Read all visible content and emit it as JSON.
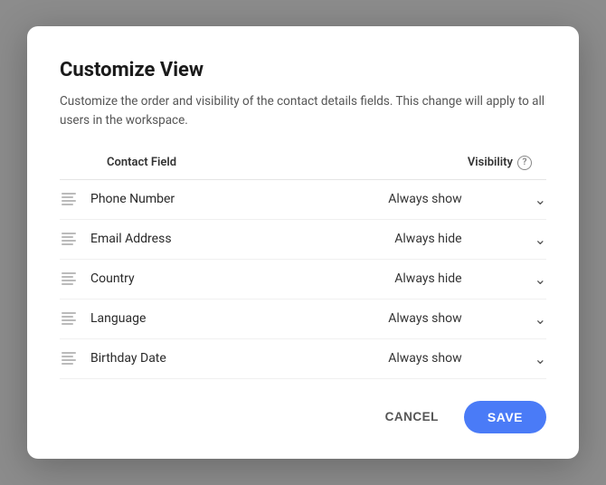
{
  "modal": {
    "title": "Customize View",
    "description": "Customize the order and visibility of the contact details fields. This change will apply to all users in the workspace.",
    "columns": {
      "field": "Contact Field",
      "visibility": "Visibility"
    },
    "rows": [
      {
        "id": "phone-number",
        "name": "Phone Number",
        "visibility": "Always show"
      },
      {
        "id": "email-address",
        "name": "Email Address",
        "visibility": "Always hide"
      },
      {
        "id": "country",
        "name": "Country",
        "visibility": "Always hide"
      },
      {
        "id": "language",
        "name": "Language",
        "visibility": "Always show"
      },
      {
        "id": "birthday-date",
        "name": "Birthday Date",
        "visibility": "Always show"
      }
    ],
    "footer": {
      "cancel": "CANCEL",
      "save": "SAVE"
    }
  }
}
